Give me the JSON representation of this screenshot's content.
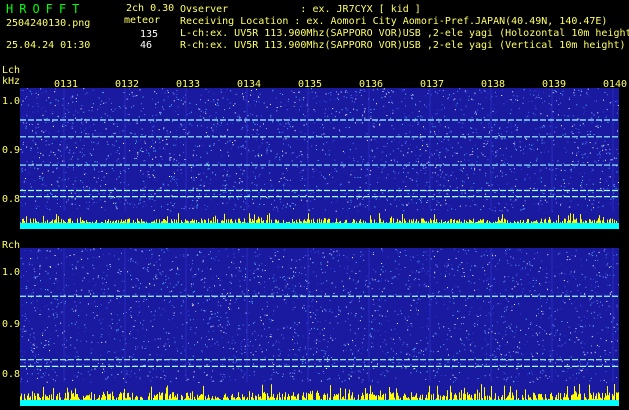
{
  "header": {
    "title": "HROFFT",
    "mode": "2ch 0.30",
    "filename": "2504240130.png",
    "meteor_label": "meteor",
    "count_l": "135",
    "count_r": "46",
    "datetime": "25.04.24 01:30"
  },
  "info": {
    "observer": "Ovserver            : ex. JR7CYX [ kid ]",
    "location": "Receiving Location : ex. Aomori City Aomori-Pref.JAPAN(40.49N, 140.47E)",
    "lch": "L-ch:ex. UV5R 113.900Mhz(SAPPORO VOR)USB ,2-ele yagi (Holozontal 10m height",
    "rch": "R-ch:ex. UV5R 113.900Mhz(SAPPORO VOR)USB ,2-ele yagi (Vertical 10m height)"
  },
  "axis": {
    "lch_label": "Lch",
    "unit": "kHz",
    "rch_label": "Rch",
    "y_l": [
      "1.0",
      "0.9",
      "0.8"
    ],
    "y_r": [
      "1.0",
      "0.9",
      "0.8"
    ],
    "times": [
      "0131",
      "0132",
      "0133",
      "0134",
      "0135",
      "0136",
      "0137",
      "0138",
      "0139",
      "0140"
    ]
  },
  "colors": {
    "bg": "#1a1aa0",
    "amp_yellow": "#ffff00",
    "amp_cyan": "#00ffff",
    "text_yellow": "#ffff66",
    "title_green": "#00ff00"
  },
  "lines_l_khz": [
    0.962,
    0.921,
    0.852,
    0.79,
    0.775
  ],
  "lines_r_khz": [
    0.932,
    0.79,
    0.775
  ]
}
